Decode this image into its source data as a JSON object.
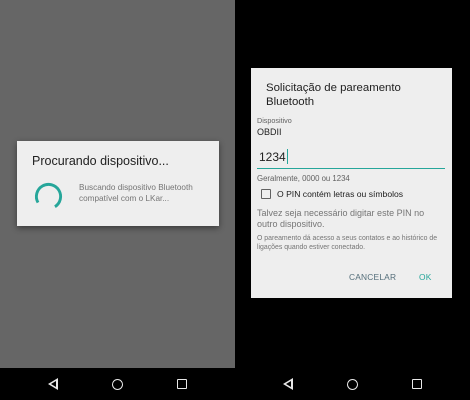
{
  "left_screen": {
    "progress_dialog": {
      "title": "Procurando dispositivo...",
      "message": "Buscando dispositivo Bluetooth compatível com o LKar...",
      "spinner_color": "#26a69a"
    }
  },
  "right_screen": {
    "pairing_dialog": {
      "title": "Solicitação de pareamento Bluetooth",
      "device_label": "Dispositivo",
      "device_name": "OBDII",
      "pin_value": "1234",
      "pin_hint": "Geralmente, 0000 ou 1234",
      "checkbox_label": "O PIN contém letras ou símbolos",
      "checkbox_checked": false,
      "pin_info": "Talvez seja necessário digitar este PIN no outro dispositivo.",
      "pairing_note": "O pareamento dá acesso a seus contatos e ao histórico de ligações quando estiver conectado.",
      "cancel_label": "CANCELAR",
      "ok_label": "OK",
      "accent_color": "#26a69a"
    }
  },
  "navbar": {
    "icons": [
      "back-icon",
      "home-icon",
      "recents-icon"
    ]
  }
}
